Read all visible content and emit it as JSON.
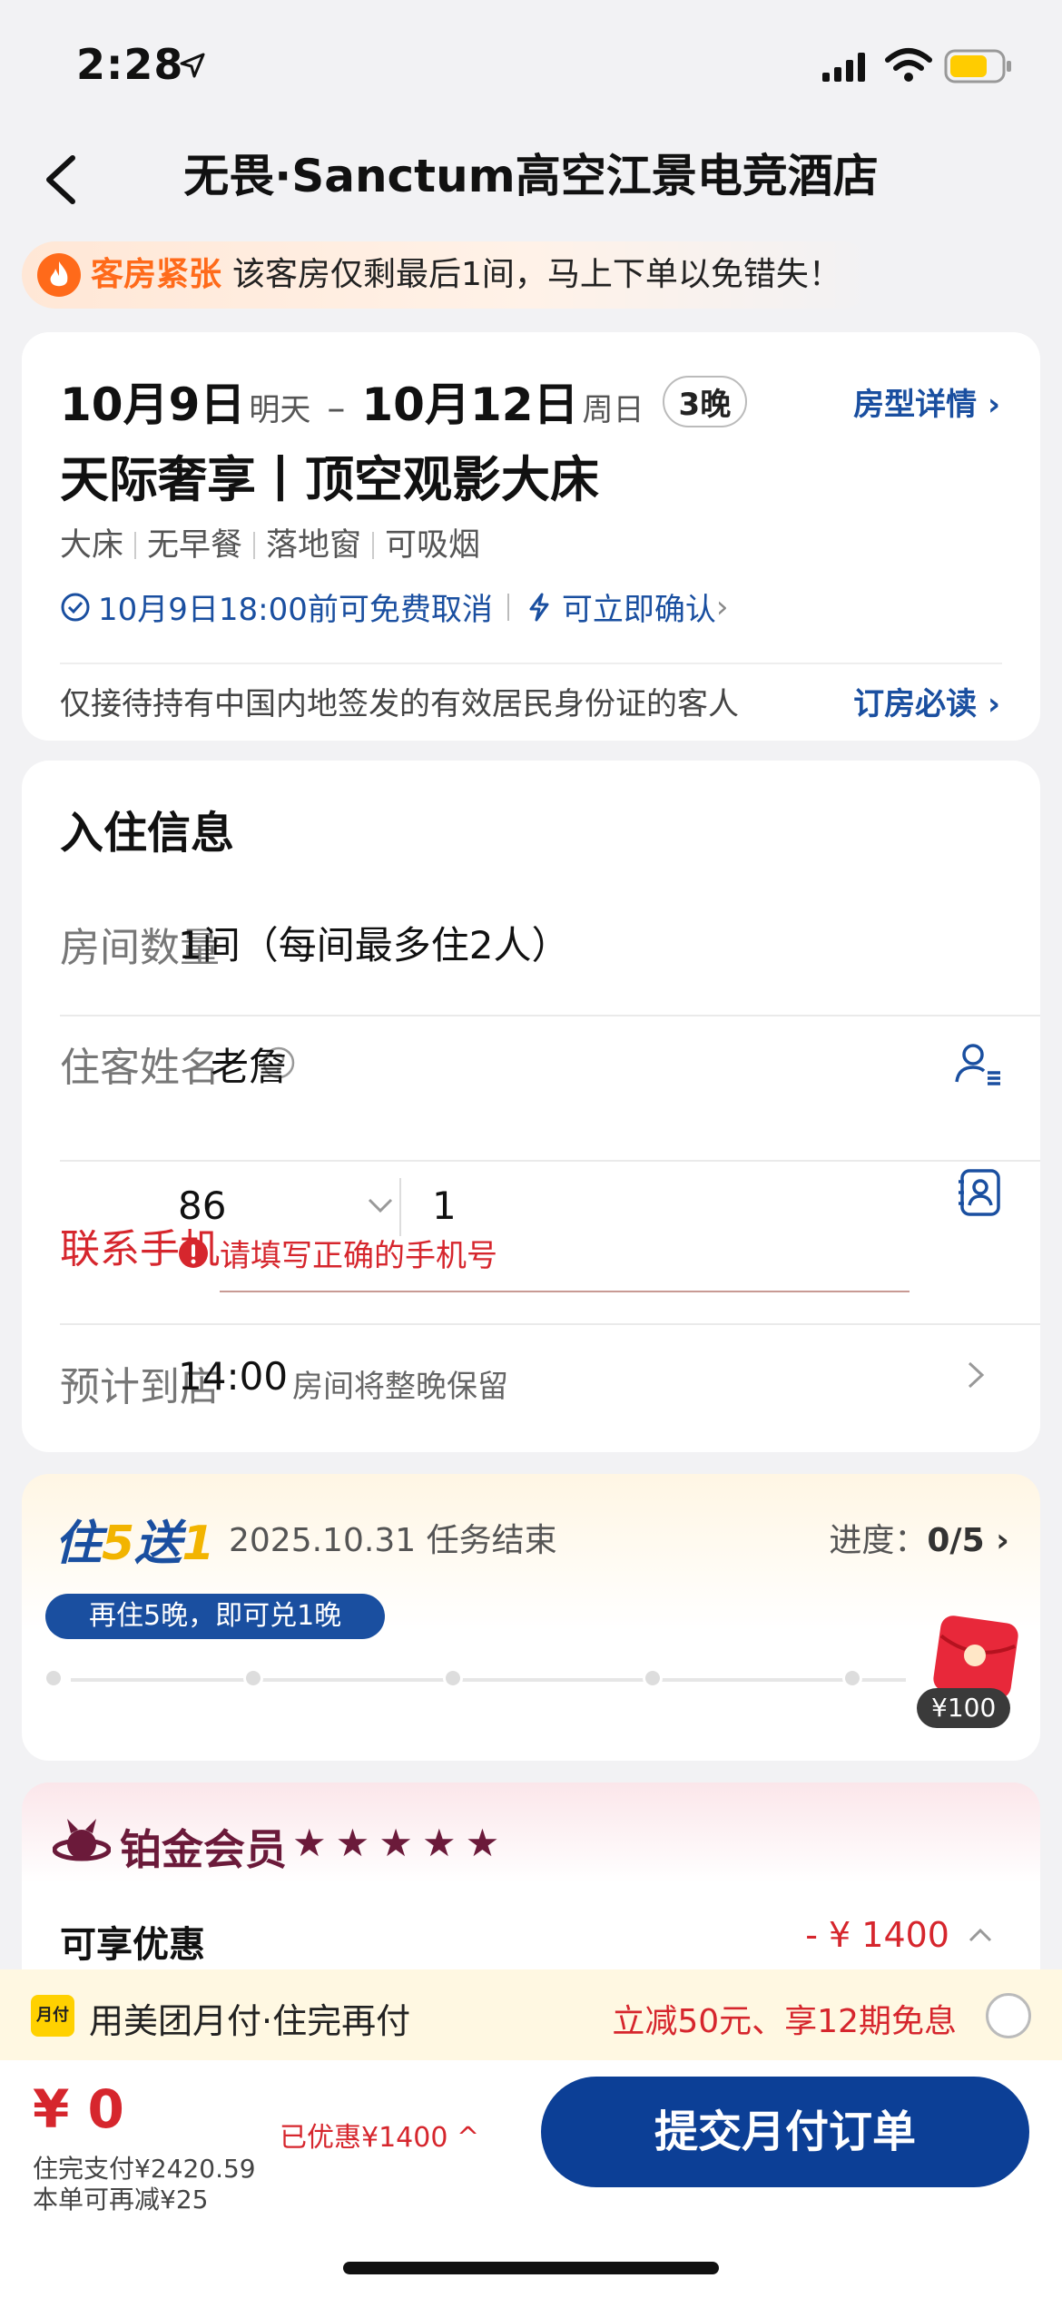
{
  "status_bar": {
    "time": "2:28"
  },
  "header": {
    "title": "无畏·Sanctum高空江景电竞酒店"
  },
  "notice": {
    "tag": "客房紧张",
    "message": "该客房仅剩最后1间，马上下单以免错失！"
  },
  "room": {
    "checkin_date": "10月9日",
    "checkin_day": "明天",
    "dash": "–",
    "checkout_date": "10月12日",
    "checkout_day": "周日",
    "nights": "3晚",
    "detail_link": "房型详情",
    "name": "天际奢享丨顶空观影大床",
    "features": [
      "大床",
      "无早餐",
      "落地窗",
      "可吸烟"
    ],
    "cancel_policy": "10月9日18:00前可免费取消",
    "confirm": "可立即确认",
    "id_note": "仅接待持有中国内地签发的有效居民身份证的客人",
    "notes_link": "订房必读"
  },
  "checkin": {
    "title": "入住信息",
    "rooms_label": "房间数量",
    "rooms_value": "1间（每间最多住2人）",
    "guest_label": "住客姓名",
    "guest_value": "老詹",
    "phone_label": "联系手机",
    "phone_code": "86",
    "phone_value": "1",
    "phone_error": "请填写正确的手机号",
    "arrival_label": "预计到店",
    "arrival_time": "14:00",
    "arrival_note": "房间将整晚保留"
  },
  "mission": {
    "title_a": "住",
    "title_b": "5",
    "title_c": "送",
    "title_d": "1",
    "end": "2025.10.31 任务结束",
    "progress_label": "进度：",
    "progress_value": "0/5",
    "progress_fraction": 0,
    "bubble": "再住5晚，即可兑1晚",
    "reward": "¥100"
  },
  "member": {
    "title": "铂金会员",
    "stars": "★★★★★",
    "discount_label": "可享优惠",
    "discount_value": "- ¥ 1400"
  },
  "pay": {
    "icon_text": "月付",
    "label": "用美团月付·住完再付",
    "promo": "立减50元、享12期免息"
  },
  "bottom": {
    "price": "¥ 0",
    "line1": "住完支付¥2420.59",
    "line2": "本单可再减¥25",
    "saved": "已优惠¥1400",
    "submit": "提交月付订单"
  },
  "colors": {
    "brand_blue": "#0c3f96",
    "error_red": "#d6262d",
    "accent_orange": "#ff6a1a",
    "member_purple": "#6b1a3a"
  }
}
